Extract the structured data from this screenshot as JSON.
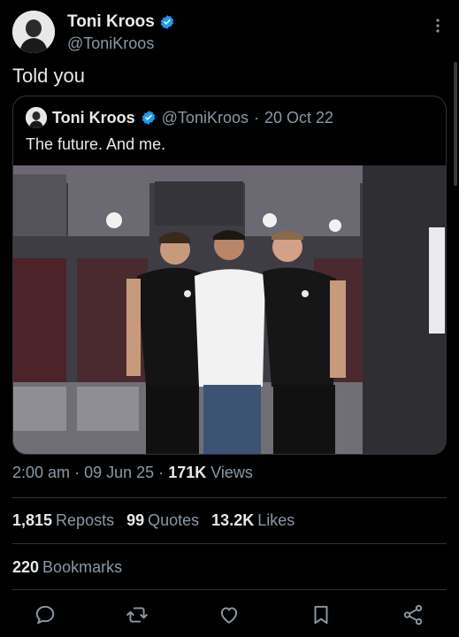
{
  "author": {
    "display_name": "Toni Kroos",
    "handle": "@ToniKroos",
    "verified": true
  },
  "tweet": {
    "text": "Told you"
  },
  "quoted_tweet": {
    "display_name": "Toni Kroos",
    "handle": "@ToniKroos",
    "separator": "·",
    "date": "20 Oct 22",
    "text": "The future. And me."
  },
  "meta": {
    "time": "2:00 am",
    "separator": "·",
    "date": "09 Jun 25",
    "views_count": "171K",
    "views_label": "Views"
  },
  "stats": {
    "reposts_count": "1,815",
    "reposts_label": "Reposts",
    "quotes_count": "99",
    "quotes_label": "Quotes",
    "likes_count": "13.2K",
    "likes_label": "Likes",
    "bookmarks_count": "220",
    "bookmarks_label": "Bookmarks"
  },
  "icons": {
    "reply": "reply-icon",
    "repost": "repost-icon",
    "like": "heart-icon",
    "bookmark": "bookmark-icon",
    "share": "share-icon",
    "more": "more-icon",
    "verified": "verified-badge-icon"
  },
  "colors": {
    "background": "#000000",
    "text_primary": "#e7e9ea",
    "text_secondary": "#8b98a5",
    "verified_blue": "#1d9bf0",
    "divider": "#2f3336"
  }
}
